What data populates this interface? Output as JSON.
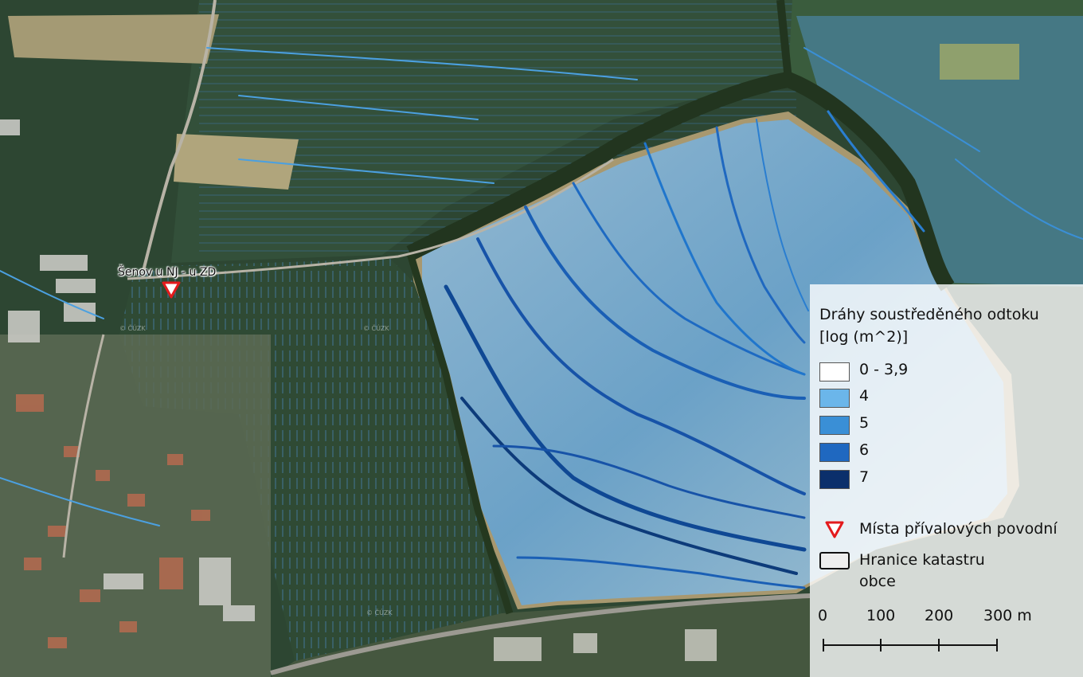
{
  "map": {
    "site_label": "Šenov u NJ - u ZD",
    "watermark": "© ČÚZK",
    "colors": {
      "field_green": "#2f4a34",
      "field_tan": "#a89a72",
      "runoff_light": "#5aaee8",
      "runoff_mid": "#2f86d2",
      "runoff_dark": "#0d3b7a",
      "marker_red": "#e31a1c"
    }
  },
  "legend": {
    "title_line1": "Dráhy soustředěného odtoku",
    "title_line2": "[log (m^2)]",
    "classes": [
      {
        "label": "0 - 3,9",
        "color": "#ffffff"
      },
      {
        "label": "4",
        "color": "#6bb6ea"
      },
      {
        "label": "5",
        "color": "#3a8fd6"
      },
      {
        "label": "6",
        "color": "#1f68c0"
      },
      {
        "label": "7",
        "color": "#0b2f6b"
      }
    ],
    "marker_label": "Místa přívalových povodní",
    "marker_icon": "red-downward-triangle-icon",
    "boundary_label_line1": "Hranice katastru",
    "boundary_label_line2": "obce"
  },
  "scale_bar": {
    "ticks": [
      "0",
      "100",
      "200",
      "300 m"
    ]
  }
}
